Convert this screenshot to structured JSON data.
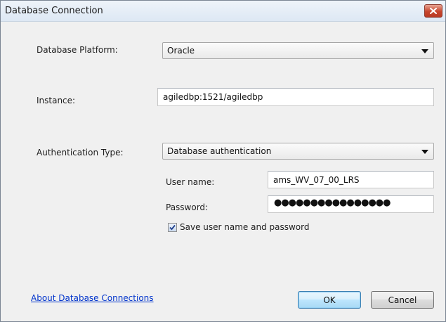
{
  "window": {
    "title": "Database Connection"
  },
  "form": {
    "platform_label": "Database Platform:",
    "platform_value": "Oracle",
    "instance_label": "Instance:",
    "instance_value": "agiledbp:1521/agiledbp",
    "auth_label": "Authentication Type:",
    "auth_value": "Database authentication",
    "username_label": "User name:",
    "username_value": "ams_WV_07_00_LRS",
    "password_label": "Password:",
    "password_value": "●●●●●●●●●●●●●●●●",
    "save_label": "Save user name and password",
    "save_checked": true
  },
  "footer": {
    "link_text": "About Database Connections",
    "ok_label": "OK",
    "cancel_label": "Cancel"
  },
  "icons": {
    "close": "close-icon",
    "dropdown": "chevron-down-icon",
    "check": "check-icon"
  }
}
